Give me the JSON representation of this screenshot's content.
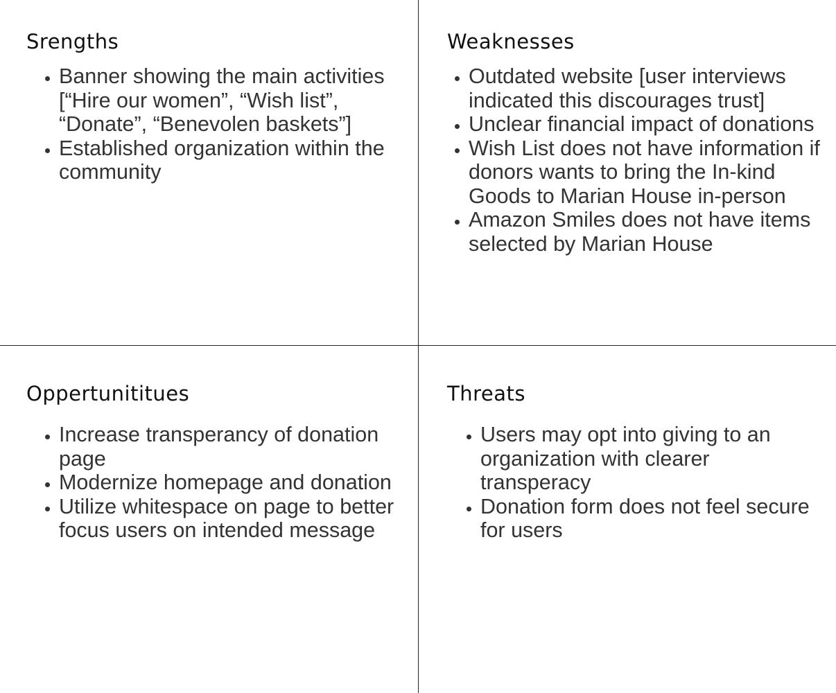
{
  "strengths": {
    "title": "Srengths",
    "items": [
      "Banner showing the main activities [“Hire our women”, “Wish list”,  “Donate”, “Benevolen baskets”]",
      "Established organization within the community"
    ]
  },
  "weaknesses": {
    "title": "Weaknesses",
    "items": [
      "Outdated website [user interviews indicated this discourages trust]",
      "Unclear financial impact of donations",
      "Wish List does not have information if donors wants to bring the In-kind Goods to Marian House in-person",
      "Amazon Smiles does not have items selected by Marian House"
    ]
  },
  "opportunities": {
    "title": "Oppertunititues",
    "items": [
      "Increase transperancy of donation page",
      "Modernize homepage and donation",
      "Utilize whitespace on page to better focus users on intended message"
    ]
  },
  "threats": {
    "title": "Threats",
    "items": [
      "Users may opt into giving to an organization with clearer transperacy",
      "Donation form does not feel secure for users"
    ]
  }
}
